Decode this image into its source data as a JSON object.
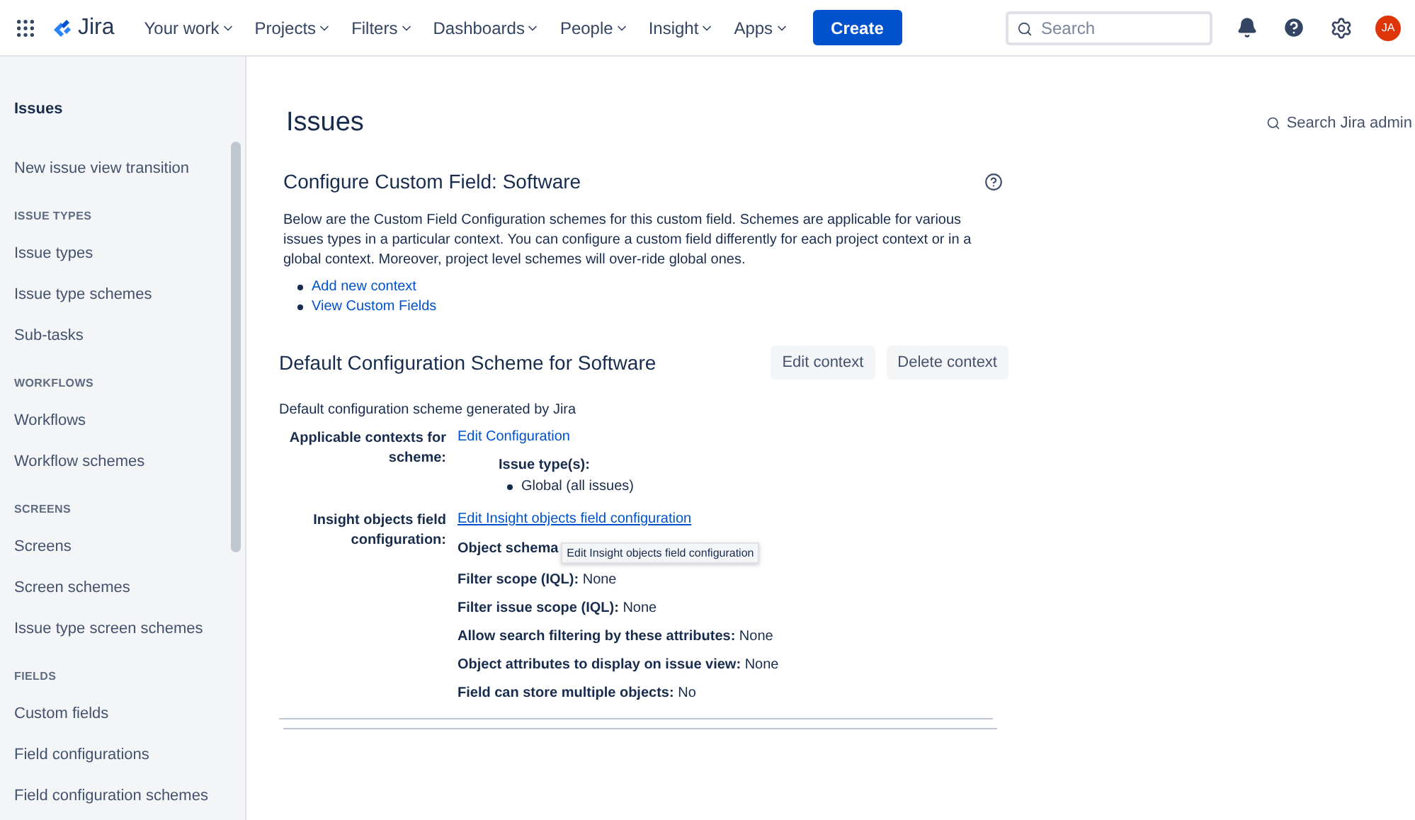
{
  "nav": {
    "logo": "Jira",
    "items": [
      {
        "label": "Your work"
      },
      {
        "label": "Projects"
      },
      {
        "label": "Filters"
      },
      {
        "label": "Dashboards"
      },
      {
        "label": "People"
      },
      {
        "label": "Insight"
      },
      {
        "label": "Apps"
      }
    ],
    "create": "Create",
    "search": {
      "placeholder": "Search"
    },
    "avatar": "JA"
  },
  "sidebar": {
    "title": "Issues",
    "sections": [
      {
        "items": [
          {
            "label": "New issue view transition"
          }
        ]
      },
      {
        "heading": "ISSUE TYPES",
        "items": [
          {
            "label": "Issue types"
          },
          {
            "label": "Issue type schemes"
          },
          {
            "label": "Sub-tasks"
          }
        ]
      },
      {
        "heading": "WORKFLOWS",
        "items": [
          {
            "label": "Workflows"
          },
          {
            "label": "Workflow schemes"
          }
        ]
      },
      {
        "heading": "SCREENS",
        "items": [
          {
            "label": "Screens"
          },
          {
            "label": "Screen schemes"
          },
          {
            "label": "Issue type screen schemes"
          }
        ]
      },
      {
        "heading": "FIELDS",
        "items": [
          {
            "label": "Custom fields"
          },
          {
            "label": "Field configurations"
          },
          {
            "label": "Field configuration schemes"
          }
        ]
      }
    ]
  },
  "page": {
    "title": "Issues",
    "admin_search": "Search Jira admin",
    "heading": "Configure Custom Field: Software",
    "description": "Below are the Custom Field Configuration schemes for this custom field. Schemes are applicable for various issues types in a particular context. You can configure a custom field differently for each project context or in a global context. Moreover, project level schemes will over-ride global ones.",
    "links": [
      "Add new context",
      "View Custom Fields"
    ],
    "scheme": {
      "title": "Default Configuration Scheme for Software",
      "buttons": [
        "Edit context",
        "Delete context"
      ],
      "description": "Default configuration scheme generated by Jira",
      "contexts": {
        "label": "Applicable contexts for scheme:",
        "link": "Edit Configuration",
        "issue_types_label": "Issue type(s):",
        "issue_types": [
          "Global (all issues)"
        ]
      },
      "insight": {
        "label": "Insight objects field configuration:",
        "link": "Edit Insight objects field configuration",
        "tooltip": "Edit Insight objects field configuration",
        "properties": [
          "**Object schema**",
          "**Filter scope (IQL):** None",
          "**Filter issue scope (IQL):** None",
          "**Allow search filtering by these attributes:** None",
          "**Object attributes to display on issue view:** None",
          "**Field can store multiple objects:** No"
        ]
      }
    }
  }
}
